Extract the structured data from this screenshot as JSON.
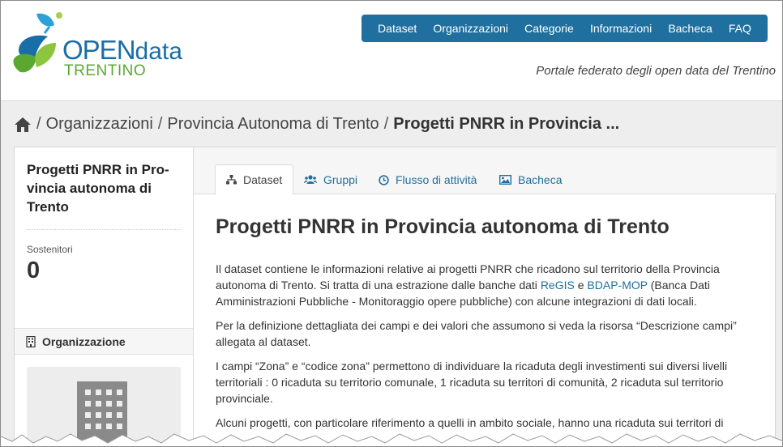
{
  "logo": {
    "open": "OPEN",
    "data": "data",
    "region": "TRENTINO"
  },
  "nav": [
    {
      "label": "Dataset"
    },
    {
      "label": "Organizzazioni"
    },
    {
      "label": "Categorie"
    },
    {
      "label": "Informazioni"
    },
    {
      "label": "Bacheca"
    },
    {
      "label": "FAQ"
    }
  ],
  "tagline": "Portale federato degli open data del Trentino",
  "breadcrumb": {
    "home_icon": "home-icon",
    "items": [
      "Organizzazioni",
      "Provincia Autonoma di Trento"
    ],
    "current": "Progetti PNRR in Provincia ...",
    "separator": "/"
  },
  "sidebar": {
    "title": "Progetti PNRR in Pro-vincia autonoma di Trento",
    "followers_label": "Sostenitori",
    "followers_count": "0",
    "org_heading": "Organizzazione",
    "org_icon": "building-icon"
  },
  "tabs": [
    {
      "label": "Dataset",
      "icon": "sitemap-icon"
    },
    {
      "label": "Gruppi",
      "icon": "users-icon"
    },
    {
      "label": "Flusso di attività",
      "icon": "clock-icon"
    },
    {
      "label": "Bacheca",
      "icon": "image-icon"
    }
  ],
  "main": {
    "title": "Progetti PNRR in Provincia autonoma di Trento",
    "p1_a": "Il dataset contiene le informazioni relative ai progetti PNRR che ricadono sul territorio della Provincia autonoma di Trento. Si tratta di una estrazione dalle banche dati ",
    "p1_link1": "ReGIS",
    "p1_b": " e ",
    "p1_link2": "BDAP-MOP",
    "p1_c": " (Banca Dati Amministrazioni Pubbliche - Monitoraggio opere pubbliche) con alcune integrazioni di dati locali.",
    "p2": "Per la definizione dettagliata dei campi e dei valori che assumono si veda la risorsa “Descrizione campi” allegata al dataset.",
    "p3": "I campi “Zona” e “codice zona” permettono di individuare la ricaduta degli investimenti sui diversi livelli territoriali : 0 ricaduta su territorio comunale, 1 ricaduta su territori di comunità, 2 ricaduta sul territorio provinciale.",
    "p4": "Alcuni progetti, con particolare riferimento a quelli in ambito sociale, hanno una ricaduta sui territori di"
  },
  "colors": {
    "nav_bg": "#1f6f9f",
    "link": "#1f6f9f",
    "band": "#eeeeee"
  }
}
